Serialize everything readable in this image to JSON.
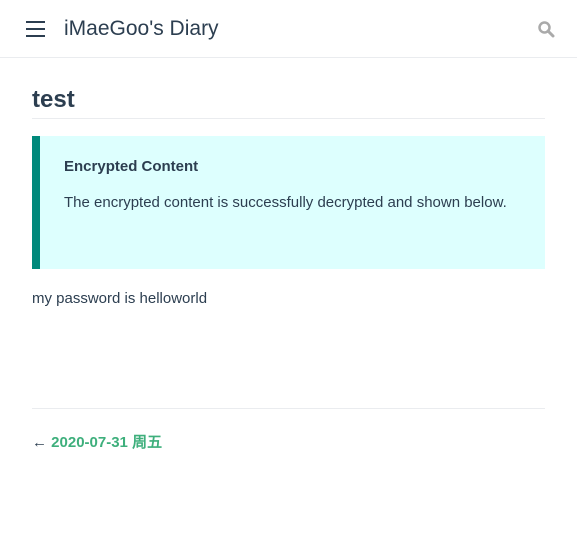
{
  "header": {
    "title": "iMaeGoo's Diary",
    "menu_icon": "hamburger-icon",
    "search_icon": "search-icon"
  },
  "page": {
    "title": "test",
    "notice": {
      "title": "Encrypted Content",
      "text": "The encrypted content is successfully decrypted and shown below."
    },
    "content": "my password is helloworld"
  },
  "footer": {
    "prev_arrow": "←",
    "prev_label": "2020-07-31 周五"
  },
  "colors": {
    "accent": "#3eaf7c",
    "notice_bg": "#ddfffe",
    "notice_border": "#00897b"
  }
}
